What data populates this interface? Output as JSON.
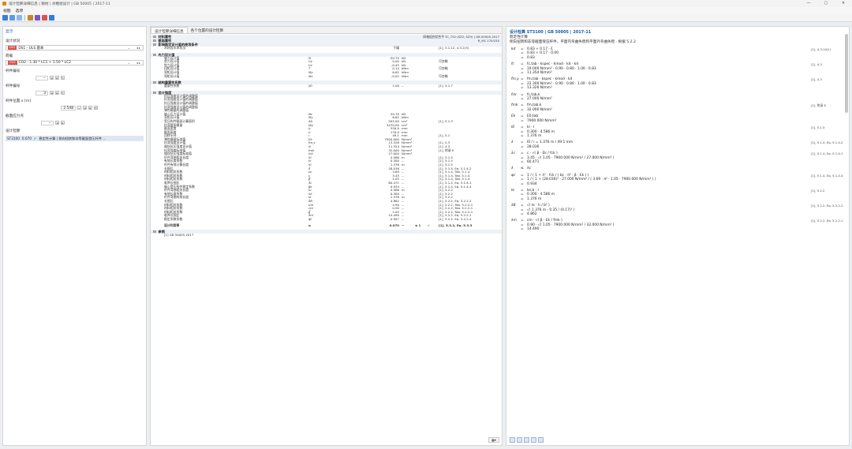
{
  "window": {
    "title": "设计检算详细信息 | 钢材 | 冰糖组设计 | GB 50005 | 2017-11",
    "controls": [
      "—",
      "▢",
      "✕"
    ]
  },
  "menu": {
    "items": [
      "视图",
      "选项"
    ]
  },
  "left": {
    "header": "显示",
    "design_situation_label": "设计状况",
    "design_situation_badge": "DS1",
    "design_situation_value": "DS1 - ULS 基本",
    "load_combo_label": "荷载",
    "load_combo_badge": "CO2",
    "load_combo_value": "CO2 - 1.30 * LC1 + 1.50 * LC2",
    "member_label": "杆件编号",
    "member_value": "--",
    "component_label": "杆件编号",
    "component_value": "3",
    "location_label": "杆件位置 x [m]",
    "location_value": "2.548",
    "section_label": "截面应力点",
    "section_value": "--",
    "check_label": "设计检算",
    "check_row": {
      "id": "ST3100",
      "ratio": "0.070",
      "desc": "稳定性计算 | 侧向扭转和非等截面受压杆件 ..."
    }
  },
  "mid": {
    "tabs": [
      "设计检算详细信息",
      "各个位置的设计检算"
    ],
    "info_line1": "网格组合验合平 TC_T32 (SZ2, SZ3) | GB 50005-2017",
    "info_line2": "R_M1 170/150",
    "rows": [
      {
        "t": "group",
        "label": "材料属性"
      },
      {
        "t": "group",
        "label": "截面属性"
      },
      {
        "t": "group",
        "label": "影响稳定设计值的使用条件"
      },
      {
        "t": "row",
        "label": "木材含水率状况",
        "sym": "",
        "val": "干燥",
        "unit": "",
        "ref": "[1], 3.1.12, 4.3.2(3)"
      },
      {
        "t": "gap"
      },
      {
        "t": "group",
        "label": "内力设计值"
      },
      {
        "t": "row",
        "label": "轴力设计值",
        "sym": "N",
        "val": "-30.70",
        "unit": "kN",
        "ref": ""
      },
      {
        "t": "row",
        "label": "剪力设计值",
        "sym": "Vy",
        "val": "0.00",
        "unit": "kN",
        "ref": "可忽略"
      },
      {
        "t": "row",
        "label": "剪力设计值",
        "sym": "Vz",
        "val": "-0.45",
        "unit": "kN",
        "ref": ""
      },
      {
        "t": "row",
        "label": "扭矩设计值",
        "sym": "T",
        "val": "0.14",
        "unit": "kNm",
        "ref": "可忽略"
      },
      {
        "t": "row",
        "label": "弯矩设计值",
        "sym": "My",
        "val": "6.62",
        "unit": "kNm",
        "ref": ""
      },
      {
        "t": "row",
        "label": "弯矩设计值",
        "sym": "Mz",
        "val": "-0.02",
        "unit": "kNm",
        "ref": "可忽略"
      },
      {
        "t": "gap"
      },
      {
        "t": "group",
        "label": "结构重要性系数"
      },
      {
        "t": "row",
        "label": "重要性系数",
        "sym": "γ0",
        "val": "1.00",
        "unit": "--",
        "ref": "[1], 4.1.7"
      },
      {
        "t": "gap"
      },
      {
        "t": "group",
        "label": "设计强度"
      },
      {
        "t": "row",
        "label": "抗压强度设计值的调整值",
        "sym": "",
        "val": "",
        "unit": "",
        "ref": ""
      },
      {
        "t": "row",
        "label": "抗弯强度设计值的调整值",
        "sym": "",
        "val": "",
        "unit": "",
        "ref": ""
      },
      {
        "t": "row",
        "label": "抗压强度设计值的调整值",
        "sym": "",
        "val": "",
        "unit": "",
        "ref": ""
      },
      {
        "t": "row",
        "label": "抗弯强度设计值的调整值",
        "sym": "",
        "val": "",
        "unit": "",
        "ref": ""
      },
      {
        "t": "row",
        "label": "弹性模量的调整值",
        "sym": "",
        "val": "",
        "unit": "",
        "ref": ""
      },
      {
        "t": "row",
        "label": "轴心压力设计值",
        "sym": "Nc",
        "val": "30.70",
        "unit": "kN",
        "ref": ""
      },
      {
        "t": "row",
        "label": "弯矩设计值",
        "sym": "My",
        "val": "6.62",
        "unit": "kNm",
        "ref": ""
      },
      {
        "t": "row",
        "label": "受压构件截面计算面积",
        "sym": "A0",
        "val": "505.00",
        "unit": "cm²",
        "ref": "[1], 5.1.3"
      },
      {
        "t": "row",
        "label": "抗弯截面模量",
        "sym": "Wy",
        "val": "3470.00",
        "unit": "cm³",
        "ref": ""
      },
      {
        "t": "row",
        "label": "截面宽度",
        "sym": "b",
        "val": "350.0",
        "unit": "mm",
        "ref": ""
      },
      {
        "t": "row",
        "label": "截面高度",
        "sym": "h",
        "val": "170.0",
        "unit": "mm",
        "ref": ""
      },
      {
        "t": "row",
        "label": "回转半径",
        "sym": "i",
        "val": "49.1",
        "unit": "mm",
        "ref": "[1], 5.1"
      },
      {
        "t": "row",
        "label": "弹性模量标准值",
        "sym": "Ek",
        "val": "7900.000",
        "unit": "N/mm²",
        "ref": ""
      },
      {
        "t": "row",
        "label": "抗弯强度设计值",
        "sym": "fm,y",
        "val": "13.326",
        "unit": "N/mm²",
        "ref": "[1], 4.3"
      },
      {
        "t": "row",
        "label": "顺纹抗压强度设计值",
        "sym": "fc",
        "val": "11.354",
        "unit": "N/mm²",
        "ref": "[1], 4.3"
      },
      {
        "t": "row",
        "label": "抗弯强度标准值",
        "sym": "fmk",
        "val": "32.000",
        "unit": "N/mm²",
        "ref": "[1], 附录 E"
      },
      {
        "t": "row",
        "label": "顺纹抗压强度标准值",
        "sym": "fck",
        "val": "27.000",
        "unit": "N/mm²",
        "ref": ""
      },
      {
        "t": "row",
        "label": "杆件弯曲相关长度",
        "sym": "l0",
        "val": "4.586",
        "unit": "m",
        "ref": "[1], 5.1.5"
      },
      {
        "t": "row",
        "label": "有效长度系数",
        "sym": "kl",
        "val": "0.300",
        "unit": "--",
        "ref": "[1], 5.1.5"
      },
      {
        "t": "row",
        "label": "杆件有效计算长度",
        "sym": "l0",
        "val": "1.376",
        "unit": "m",
        "ref": "[1], 5.1.5"
      },
      {
        "t": "row",
        "label": "长细比",
        "sym": "λ",
        "val": "28.036",
        "unit": "--",
        "ref": "[1], 5.1.4, Eq. 5.1.4-2"
      },
      {
        "t": "row",
        "label": "材料相关系数",
        "sym": "bc",
        "val": "3.69",
        "unit": "--",
        "ref": "[1], 5.1.4, Tab. 5.1.4"
      },
      {
        "t": "row",
        "label": "材料相关系数",
        "sym": "c",
        "val": "3.45",
        "unit": "--",
        "ref": "[1], 5.1.4, Tab. 5.1.4"
      },
      {
        "t": "row",
        "label": "材料相关系数",
        "sym": "β",
        "val": "1.05",
        "unit": "--",
        "ref": "[1], 5.1.4, Tab. 5.1.4"
      },
      {
        "t": "row",
        "label": "临界长细比",
        "sym": "λc",
        "val": "60.471",
        "unit": "--",
        "ref": "[1], 5.1.4, Eq. 5.1.4-1"
      },
      {
        "t": "row",
        "label": "轴心受压构件稳定系数",
        "sym": "φc",
        "val": "0.934",
        "unit": "--",
        "ref": "[1], 5.1.4, Eq. 5.1.4-4"
      },
      {
        "t": "row",
        "label": "杆件弯曲相关长度",
        "sym": "lu",
        "val": "4.586",
        "unit": "m",
        "ref": "[1], 5.2.2"
      },
      {
        "t": "row",
        "label": "有效长度系数",
        "sym": "ke",
        "val": "0.300",
        "unit": "--",
        "ref": "[1], 5.2.2"
      },
      {
        "t": "row",
        "label": "杆件弯曲有效长度",
        "sym": "le",
        "val": "1.376",
        "unit": "m",
        "ref": "[1], 5.2.2"
      },
      {
        "t": "row",
        "label": "长细比",
        "sym": "λB",
        "val": "4.862",
        "unit": "--",
        "ref": "[1], 5.2.2, Eq. 5.2.2-2"
      },
      {
        "t": "row",
        "label": "材料相关系数",
        "sym": "bm",
        "val": "4.90",
        "unit": "--",
        "ref": "[1], 5.2.2, Tab. 5.2.2-1"
      },
      {
        "t": "row",
        "label": "材料相关系数",
        "sym": "cm",
        "val": "0.90",
        "unit": "--",
        "ref": "[1], 5.2.2, Tab. 5.2.2-1"
      },
      {
        "t": "row",
        "label": "材料相关系数",
        "sym": "β",
        "val": "1.05",
        "unit": "--",
        "ref": "[1], 5.2.2, Tab. 5.2.2-1"
      },
      {
        "t": "row",
        "label": "临界长细比",
        "sym": "λm",
        "val": "14.490",
        "unit": "--",
        "ref": "[1], 5.2.2, Eq. 5.2.2-1"
      },
      {
        "t": "row",
        "label": "稳定系数系数",
        "sym": "φl",
        "val": "0.997",
        "unit": "--",
        "ref": "[1], 5.2.2, Eq. 5.2.2-4"
      },
      {
        "t": "gap"
      },
      {
        "t": "ratio",
        "label": "设计利用率",
        "sym": "η",
        "val": "0.070",
        "unit": "--",
        "rel": "≤ 1",
        "ref": "[1], 5.3.2, Eq. 5.3.3"
      },
      {
        "t": "gap"
      },
      {
        "t": "group",
        "label": "参照"
      },
      {
        "t": "row",
        "label": "[1]  GB 50005-2017",
        "sym": "",
        "val": "",
        "unit": "",
        "ref": ""
      }
    ]
  },
  "right": {
    "title": "设计检算 ST3100 | GB 50005 | 2017-11",
    "subtitle1": "稳定性计算",
    "subtitle2": "侧向扭转和非等截面受压杆件，平面内弯曲失稳和平面外弯曲失稳 · 根据 5.2.2",
    "lines": [
      {
        "sym": "kd",
        "op": "=",
        "expr": "0.83 + 0.17 · ξ",
        "ref": "[1], 4.3.10(1)"
      },
      {
        "sym": "",
        "op": "=",
        "expr": "0.83 + 0.17 · 0.00",
        "ref": ""
      },
      {
        "sym": "",
        "op": "=",
        "expr": "0.83",
        "ref": ""
      },
      {
        "sym": "fc",
        "op": "=",
        "expr": "fc,tab · kspec · kmod · kd · kd",
        "ref": "[1], 4.3"
      },
      {
        "sym": "",
        "op": "=",
        "expr": "19.000 N/mm² · 0.90 · 0.80 · 1.00 · 0.83",
        "ref": ""
      },
      {
        "sym": "",
        "op": "=",
        "expr": "11.354 N/mm²",
        "ref": ""
      },
      {
        "sym": "fm,y",
        "op": "=",
        "expr": "fm,tab · kspec · kmod · kd",
        "ref": "[1], 4.3"
      },
      {
        "sym": "",
        "op": "=",
        "expr": "22.300 N/mm² · 0.90 · 0.80 · 1.00 · 0.83",
        "ref": ""
      },
      {
        "sym": "",
        "op": "=",
        "expr": "13.326 N/mm²",
        "ref": ""
      },
      {
        "sym": "fck",
        "op": "=",
        "expr": "fc,tab,k",
        "ref": ""
      },
      {
        "sym": "",
        "op": "=",
        "expr": "27.000 N/mm²",
        "ref": ""
      },
      {
        "sym": "fmk",
        "op": "=",
        "expr": "fm,tab,k",
        "ref": "[1], 附录 E"
      },
      {
        "sym": "",
        "op": "=",
        "expr": "32.000 N/mm²",
        "ref": ""
      },
      {
        "sym": "Ek",
        "op": "=",
        "expr": "E0,tab",
        "ref": ""
      },
      {
        "sym": "",
        "op": "=",
        "expr": "7900.000 N/mm²",
        "ref": ""
      },
      {
        "sym": "l0",
        "op": "=",
        "expr": "kl · l",
        "ref": "[1], 5.1.5"
      },
      {
        "sym": "",
        "op": "=",
        "expr": "0.300 · 4.586 m",
        "ref": ""
      },
      {
        "sym": "",
        "op": "=",
        "expr": "1.376 m",
        "ref": ""
      },
      {
        "sym": "λ",
        "op": "=",
        "expr": "l0 / i  =  1.376 m / 49.1 mm",
        "ref": "[1], 5.1.4, Eq. 5.1.4-2"
      },
      {
        "sym": "",
        "op": "=",
        "expr": "28.036",
        "ref": ""
      },
      {
        "sym": "λc",
        "op": "=",
        "expr": "c · √( β · Ek / fck )",
        "ref": "[1], 5.1.4, Eq. 5.1.4-1"
      },
      {
        "sym": "",
        "op": "=",
        "expr": "3.45 · √( 1.05 · 7900.000 N/mm² / 27.000 N/mm² )",
        "ref": ""
      },
      {
        "sym": "",
        "op": "=",
        "expr": "60.471",
        "ref": ""
      },
      {
        "sym": "λ",
        "op": "≤",
        "expr": "λc",
        "ref": ""
      },
      {
        "sym": "φc",
        "op": "=",
        "expr": "1 / ( 1 + λ² · fck / ( bc · π² · β · Ek ) )",
        "ref": "[1], 5.1.4, Eq. 5.1.4-4"
      },
      {
        "sym": "",
        "op": "=",
        "expr": "1 / ( 1 + (28.036)² · 27.000 N/mm² / ( 3.69 · π² · 1.05 · 7900.000 N/mm² ) )",
        "ref": ""
      },
      {
        "sym": "",
        "op": "=",
        "expr": "0.934",
        "ref": ""
      },
      {
        "sym": "le",
        "op": "=",
        "expr": "ke,b · l",
        "ref": "[1], 5.2.2"
      },
      {
        "sym": "",
        "op": "=",
        "expr": "0.300 · 4.586 m",
        "ref": ""
      },
      {
        "sym": "",
        "op": "=",
        "expr": "1.376 m",
        "ref": ""
      },
      {
        "sym": "λB",
        "op": "=",
        "expr": "√( le · h / b² )",
        "ref": "[1], 5.2.2, Eq. 5.2.2-2"
      },
      {
        "sym": "",
        "op": "=",
        "expr": "√( 1.376 m · 0.35 / (0.17)² )",
        "ref": ""
      },
      {
        "sym": "",
        "op": "=",
        "expr": "4.862",
        "ref": ""
      },
      {
        "sym": "λm",
        "op": "=",
        "expr": "cm · √( β · Ek / fmk )",
        "ref": "[1], 5.2.2, Eq. 5.2.2-1"
      },
      {
        "sym": "",
        "op": "=",
        "expr": "0.90 · √( 1.05 · 7900.000 N/mm² / 32.000 N/mm² )",
        "ref": ""
      },
      {
        "sym": "",
        "op": "=",
        "expr": "14.490",
        "ref": ""
      }
    ]
  },
  "colors": {
    "accent": "#1a5aa8",
    "badge": "#d9534f",
    "ok": "#2a9d2a"
  }
}
